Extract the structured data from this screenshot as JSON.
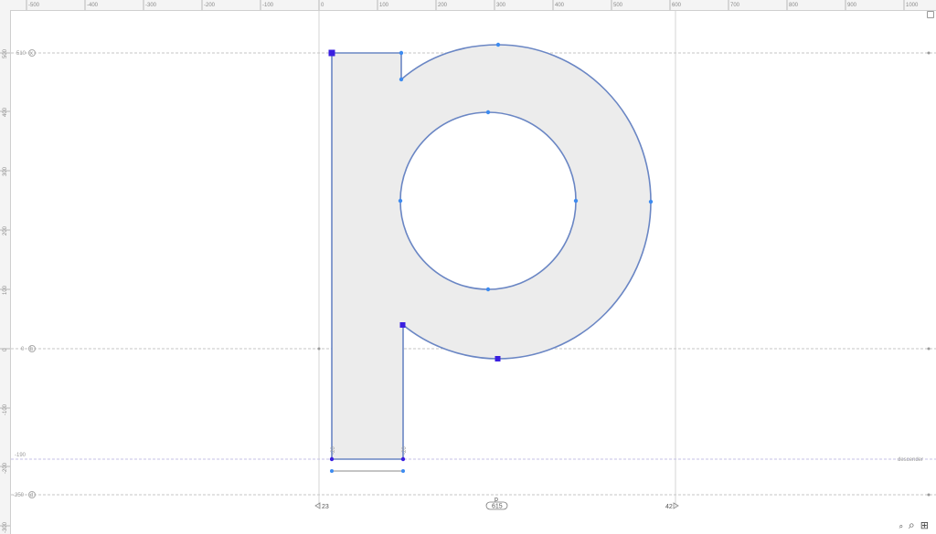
{
  "ruler": {
    "top_ticks": [
      "-500",
      "-400",
      "-300",
      "-200",
      "-100",
      "0",
      "100",
      "200",
      "300",
      "400",
      "500",
      "600",
      "700",
      "800",
      "900",
      "1000"
    ],
    "left_ticks": [
      "500",
      "400",
      "300",
      "200",
      "100",
      "0",
      "-100",
      "-200",
      "-300"
    ]
  },
  "metrics": {
    "x_height_value": "510",
    "baseline_value": "0",
    "descender_value": "-190",
    "descender_label": "descender",
    "bottom_value": "-250",
    "x_height_icon": "x",
    "baseline_icon": "b",
    "bottom_icon": "d"
  },
  "glyph": {
    "name": "p",
    "width": "615",
    "left_sidebearing": "23",
    "right_sidebearing": "42",
    "stem_label_left": "-20",
    "stem_label_right": "-20"
  },
  "tools": {
    "zoom_small_icon": "zoom-out-icon",
    "zoom_icon": "zoom-icon",
    "zoom_fit_icon": "zoom-fit-icon"
  },
  "colors": {
    "outline": "#6a86c4",
    "fill": "#ececec",
    "node": "#3d8bf0",
    "corner_node": "#3a1fe0"
  }
}
